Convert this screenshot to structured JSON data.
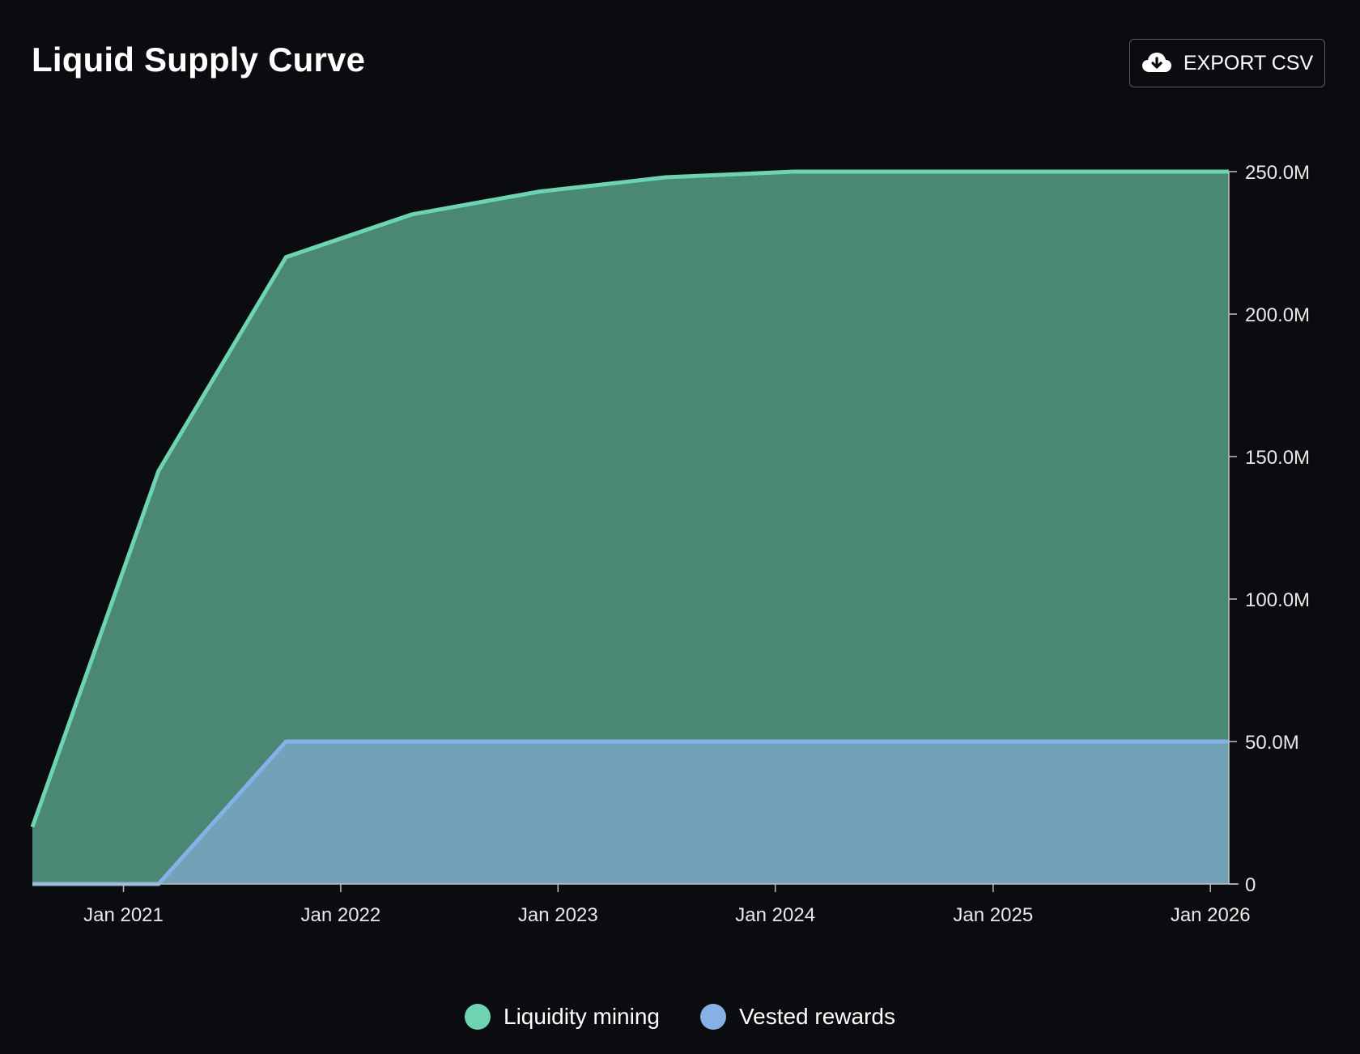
{
  "header": {
    "title": "Liquid Supply Curve",
    "export_label": "EXPORT CSV",
    "export_icon": "cloud-download-icon"
  },
  "colors": {
    "background": "#0a0c0f",
    "liquidity_line": "#6dd3b0",
    "liquidity_fill": "#4a8775",
    "vested_line": "#86b1e6",
    "vested_fill": "#72a2b8",
    "axis": "#bfbfbf"
  },
  "chart_data": {
    "type": "area",
    "stacked": true,
    "x_type": "date",
    "x": [
      "2020-08-01",
      "2021-03-01",
      "2021-10-01",
      "2022-05-01",
      "2022-12-01",
      "2023-07-01",
      "2024-02-01",
      "2024-09-01",
      "2025-04-01",
      "2025-11-01",
      "2026-02-01"
    ],
    "series": [
      {
        "name": "Vested rewards",
        "values": [
          0,
          0,
          50000000,
          50000000,
          50000000,
          50000000,
          50000000,
          50000000,
          50000000,
          50000000,
          50000000
        ]
      },
      {
        "name": "Liquidity mining",
        "values": [
          20000000,
          145000000,
          170000000,
          185000000,
          193000000,
          198000000,
          200000000,
          200000000,
          200000000,
          200000000,
          200000000
        ]
      }
    ],
    "x_ticks": [
      "Jan 2021",
      "Jan 2022",
      "Jan 2023",
      "Jan 2024",
      "Jan 2025",
      "Jan 2026"
    ],
    "x_tick_dates": [
      "2021-01-01",
      "2022-01-01",
      "2023-01-01",
      "2024-01-01",
      "2025-01-01",
      "2026-01-01"
    ],
    "y_ticks": [
      "0",
      "50.0M",
      "100.0M",
      "150.0M",
      "200.0M",
      "250.0M"
    ],
    "y_tick_values": [
      0,
      50000000,
      100000000,
      150000000,
      200000000,
      250000000
    ],
    "x_range": [
      "2020-08-01",
      "2026-02-01"
    ],
    "ylim": [
      0,
      250000000
    ],
    "y_axis_position": "right",
    "grid": false,
    "legend_position": "bottom-center"
  },
  "legend": {
    "items": [
      {
        "label": "Liquidity mining",
        "color": "#6dd3b0"
      },
      {
        "label": "Vested rewards",
        "color": "#86b1e6"
      }
    ]
  }
}
